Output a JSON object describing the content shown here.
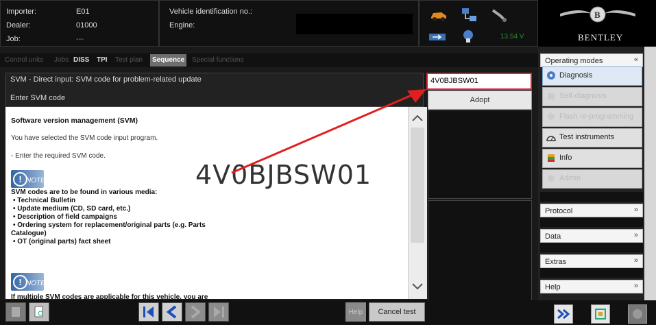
{
  "header": {
    "importer_label": "Importer:",
    "importer_value": "E01",
    "dealer_label": "Dealer:",
    "dealer_value": "01000",
    "job_label": "Job:",
    "job_value": "---",
    "vin_label": "Vehicle identification no.:",
    "engine_label": "Engine:",
    "voltage": "13.54 V",
    "brand": "BENTLEY"
  },
  "tabs": [
    {
      "label": "Control units"
    },
    {
      "label": "Jobs"
    },
    {
      "label": "DISS"
    },
    {
      "label": "TPI"
    },
    {
      "label": "Test plan"
    },
    {
      "label": "Sequence"
    },
    {
      "label": "Special functions"
    }
  ],
  "main": {
    "title_line1": "SVM - Direct input: SVM code for problem-related update",
    "title_line2": "Enter SVM code",
    "input_value": "4V0BJBSW01",
    "adopt_label": "Adopt",
    "annotation_code": "4V0BJBSW01"
  },
  "document": {
    "heading": "Software version management (SVM)",
    "para1": "You have selected the SVM code input program.",
    "para2": "- Enter the required SVM code.",
    "note_label": "NOTE",
    "note_heading": "SVM codes are to be found in various media:",
    "bullets": [
      "Technical Bulletin",
      "Update medium (CD, SD card, etc.)",
      "Description of field campaigns",
      "Ordering system for replacement/original parts (e.g. Parts",
      "Catalogue)",
      "OT (original parts) fact sheet"
    ],
    "cut_text": "If multiple SVM codes are applicable for this vehicle, you are"
  },
  "bottom": {
    "help_label": "Help",
    "cancel_label": "Cancel test"
  },
  "sidebar": {
    "operating_modes": "Operating modes",
    "modes": [
      {
        "label": "Diagnosis",
        "state": "selected"
      },
      {
        "label": "Self-diagnosis",
        "state": "disabled"
      },
      {
        "label": "Flash re-programming",
        "state": "disabled"
      },
      {
        "label": "Test instruments",
        "state": "enabled"
      },
      {
        "label": "Info",
        "state": "enabled"
      },
      {
        "label": "Admin",
        "state": "disabled"
      }
    ],
    "sections": [
      {
        "label": "Protocol"
      },
      {
        "label": "Data"
      },
      {
        "label": "Extras"
      },
      {
        "label": "Help"
      }
    ]
  },
  "colors": {
    "annotation_red": "#e02020",
    "voltage_green": "#2e8b2e",
    "selected_mode_bg": "#dfe9f5",
    "active_tab_bg": "#6e6e6e"
  }
}
